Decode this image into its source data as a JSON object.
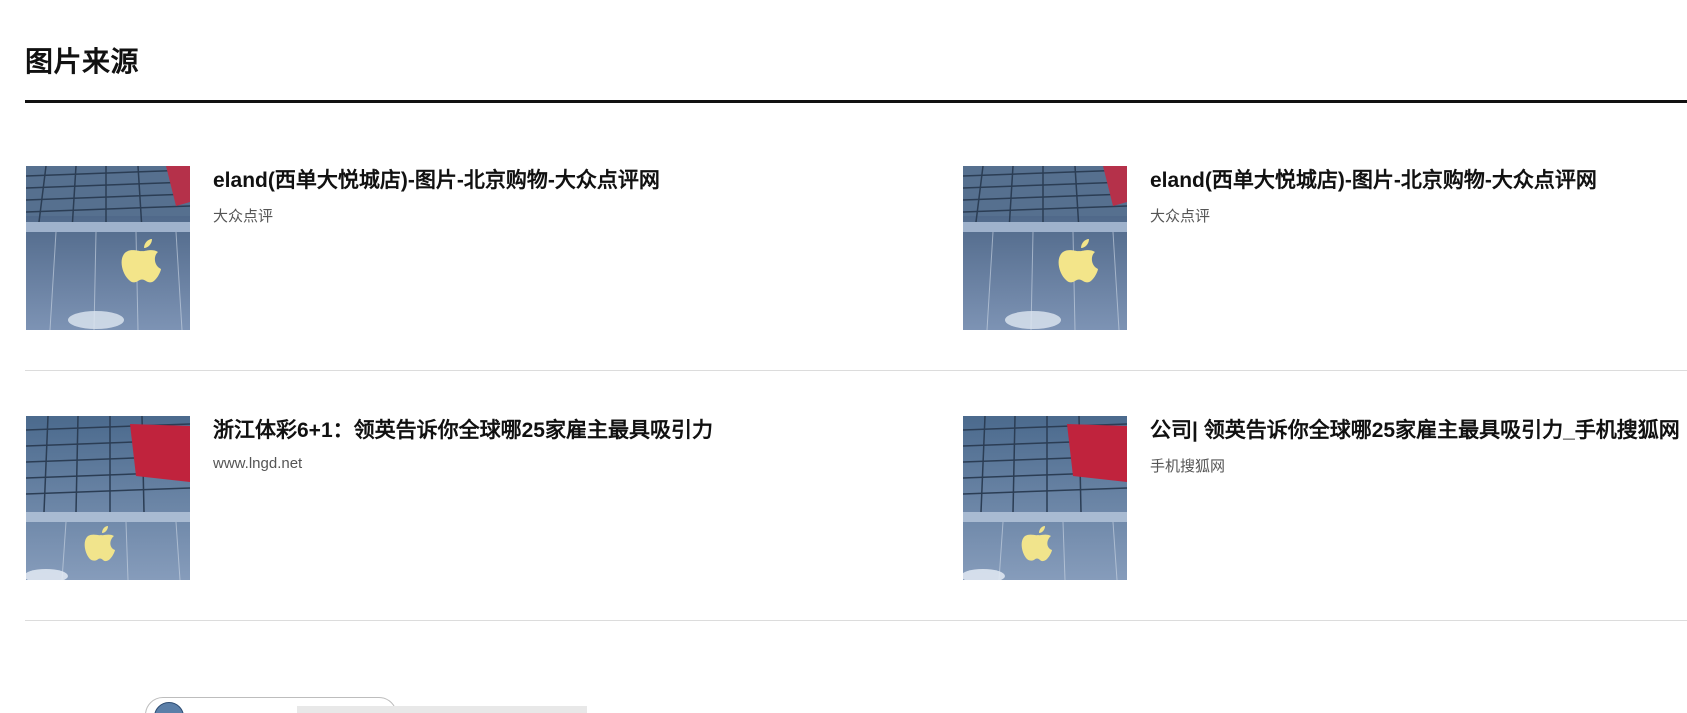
{
  "section": {
    "title": "图片来源"
  },
  "sources": [
    {
      "title": "eland(西单大悦城店)-图片-北京购物-大众点评网",
      "site": "大众点评"
    },
    {
      "title": "eland(西单大悦城店)-图片-北京购物-大众点评网",
      "site": "大众点评"
    },
    {
      "title": "浙江体彩6+1：领英告诉你全球哪25家雇主最具吸引力",
      "site": "www.lngd.net"
    },
    {
      "title": "公司| 领英告诉你全球哪25家雇主最具吸引力_手机搜狐网",
      "site": "手机搜狐网"
    }
  ],
  "colors": {
    "text": "#111111",
    "muted": "#555555",
    "divider": "#dcdcdc"
  },
  "icons": {
    "thumbnail": "apple-store-facade-image"
  }
}
